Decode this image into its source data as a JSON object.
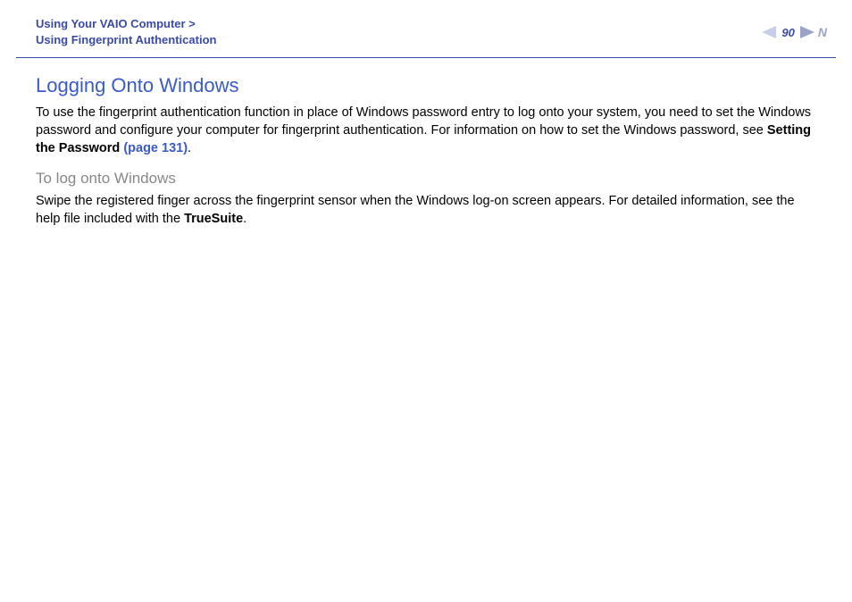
{
  "header": {
    "breadcrumb_line1": "Using Your VAIO Computer >",
    "breadcrumb_line2": "Using Fingerprint Authentication",
    "page_number": "90",
    "n_letter": "N"
  },
  "content": {
    "title": "Logging Onto Windows",
    "para1_a": "To use the fingerprint authentication function in place of Windows password entry to log onto your system, you need to set the Windows password and configure your computer for fingerprint authentication. For information on how to set the Windows password, see ",
    "para1_bold": "Setting the Password ",
    "para1_link": "(page 131)",
    "para1_end": ".",
    "subtitle": "To log onto Windows",
    "para2_a": "Swipe the registered finger across the fingerprint sensor when the Windows log-on screen appears. For detailed information, see the help file included with the ",
    "para2_bold": "TrueSuite",
    "para2_end": "."
  }
}
